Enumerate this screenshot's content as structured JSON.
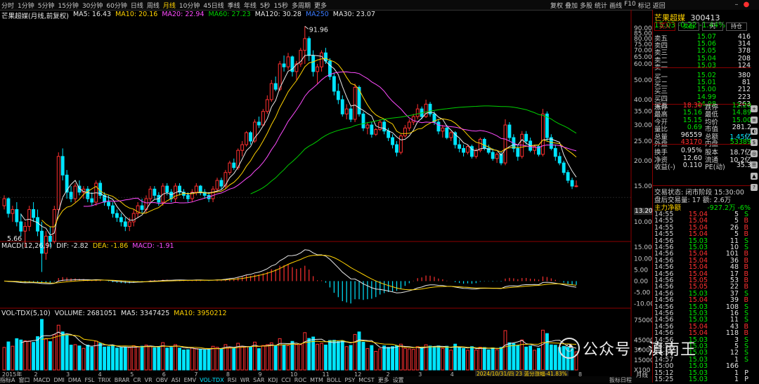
{
  "toolbar": {
    "periods": [
      "分时",
      "1分钟",
      "5分钟",
      "15分钟",
      "30分钟",
      "60分钟",
      "日线",
      "周线",
      "月线",
      "10分钟",
      "45日线",
      "季线",
      "年线",
      "5秒",
      "15秒",
      "多周期",
      "更多"
    ],
    "active_period": "月线",
    "right_tools": [
      "复权",
      "叠加",
      "多股",
      "统计",
      "画线",
      "F10",
      "标记",
      "返回"
    ]
  },
  "main_info": {
    "title": "芒果超媒(月线,前复权)",
    "ma5": "MA5: 16.43",
    "ma10": "MA10: 20.16",
    "ma20": "MA20: 22.94",
    "ma60": "MA60: 27.23",
    "ma120": "MA120: 30.28",
    "ma250": "MA250",
    "ma30": "MA30: 23.07"
  },
  "macd_info": {
    "title": "MACD(12,26,9)",
    "dif": "DIF: -2.82",
    "dea": "DEA: -1.86",
    "macd": "MACD: -1.91"
  },
  "vol_info": {
    "title": "VOL-TDX(5,10)",
    "volume": "VOLUME: 2681051",
    "ma5": "MA5: 3347425",
    "ma10": "MA10: 3950212"
  },
  "annotations": {
    "high": "91.96",
    "low": "5.66",
    "current_ref": "13.20"
  },
  "colors": {
    "up": "#ff3030",
    "down": "#00e5ff",
    "ma5": "#e8e8e8",
    "ma10": "#ffd200",
    "ma20": "#ff4cff",
    "ma60": "#00d000",
    "ma120": "#c8c8c8"
  },
  "chart_data": {
    "type": "candlestick",
    "main_axis_ticks": [
      "90.00",
      "85.00",
      "80.00",
      "75.00",
      "70.00",
      "65.00",
      "60.00",
      "50.00",
      "40.00",
      "35.00",
      "30.00",
      "25.00",
      "20.00",
      "15.00",
      "10.00"
    ],
    "macd_axis_ticks": [
      "15.00",
      "10.00",
      "5.00",
      "0.00",
      "-5.00",
      "-10.00"
    ],
    "vol_axis_ticks": [
      "75000",
      "45000",
      "30000",
      "15000",
      "X100"
    ],
    "x_labels": [
      "2015年",
      "2",
      "3",
      "4",
      "5",
      "6",
      "7",
      "8",
      "9",
      "10",
      "11",
      "12",
      "2",
      "3",
      "4",
      "5",
      "6",
      "7",
      "8"
    ],
    "candles": [
      [
        12.0,
        13.5,
        11.5,
        13.0
      ],
      [
        13.0,
        13.2,
        10.5,
        11.0
      ],
      [
        11.0,
        12.0,
        10.0,
        11.5
      ],
      [
        11.5,
        12.5,
        9.5,
        10.0
      ],
      [
        10.0,
        11.0,
        8.5,
        9.0
      ],
      [
        9.0,
        10.0,
        7.5,
        9.5
      ],
      [
        9.5,
        12.0,
        9.0,
        11.5
      ],
      [
        11.5,
        12.5,
        10.0,
        10.5
      ],
      [
        10.5,
        11.5,
        8.5,
        9.0
      ],
      [
        9.0,
        10.0,
        5.66,
        7.0
      ],
      [
        7.0,
        9.0,
        6.5,
        8.5
      ],
      [
        8.5,
        9.5,
        7.5,
        8.0
      ],
      [
        8.0,
        12.0,
        7.8,
        11.5
      ],
      [
        11.5,
        22.0,
        11.0,
        21.0
      ],
      [
        21.0,
        23.0,
        16.0,
        17.0
      ],
      [
        17.0,
        18.0,
        13.0,
        14.0
      ],
      [
        14.0,
        15.0,
        12.5,
        13.0
      ],
      [
        13.0,
        15.5,
        12.5,
        15.0
      ],
      [
        15.0,
        16.0,
        13.5,
        14.0
      ],
      [
        14.0,
        15.0,
        13.0,
        14.5
      ],
      [
        14.5,
        15.0,
        12.5,
        13.0
      ],
      [
        13.0,
        14.0,
        12.0,
        12.5
      ],
      [
        12.5,
        16.0,
        12.0,
        15.5
      ],
      [
        15.5,
        16.0,
        13.0,
        13.5
      ],
      [
        13.5,
        14.0,
        12.0,
        12.5
      ],
      [
        12.5,
        13.5,
        11.5,
        12.0
      ],
      [
        12.0,
        12.5,
        10.5,
        11.0
      ],
      [
        11.0,
        11.5,
        10.0,
        10.5
      ],
      [
        10.5,
        11.0,
        9.5,
        10.0
      ],
      [
        10.0,
        10.5,
        9.0,
        9.5
      ],
      [
        9.5,
        10.5,
        9.0,
        10.0
      ],
      [
        10.0,
        11.5,
        9.5,
        11.0
      ],
      [
        11.0,
        12.5,
        10.5,
        12.0
      ],
      [
        12.0,
        13.0,
        11.0,
        11.5
      ],
      [
        11.5,
        13.5,
        11.0,
        13.0
      ],
      [
        13.0,
        15.0,
        12.5,
        14.5
      ],
      [
        14.5,
        15.0,
        13.0,
        13.5
      ],
      [
        13.5,
        14.0,
        12.0,
        12.5
      ],
      [
        12.5,
        15.5,
        12.0,
        15.0
      ],
      [
        15.0,
        15.5,
        13.5,
        14.0
      ],
      [
        14.0,
        14.5,
        12.5,
        13.0
      ],
      [
        13.0,
        15.5,
        12.5,
        15.0
      ],
      [
        15.0,
        15.5,
        13.5,
        14.0
      ],
      [
        14.0,
        14.5,
        13.0,
        13.5
      ],
      [
        13.5,
        14.0,
        12.5,
        13.0
      ],
      [
        13.0,
        14.5,
        12.5,
        14.0
      ],
      [
        14.0,
        15.5,
        13.5,
        15.0
      ],
      [
        15.0,
        15.2,
        13.5,
        14.0
      ],
      [
        14.0,
        14.5,
        13.0,
        13.5
      ],
      [
        13.5,
        14.0,
        12.5,
        13.0
      ],
      [
        13.0,
        15.0,
        12.5,
        14.5
      ],
      [
        14.5,
        16.5,
        14.0,
        16.0
      ],
      [
        16.0,
        16.5,
        14.5,
        15.0
      ],
      [
        15.0,
        18.0,
        14.5,
        17.5
      ],
      [
        17.5,
        20.0,
        17.0,
        19.5
      ],
      [
        19.5,
        20.5,
        18.0,
        18.5
      ],
      [
        18.5,
        23.0,
        18.0,
        22.5
      ],
      [
        22.5,
        25.0,
        21.0,
        24.0
      ],
      [
        24.0,
        28.0,
        23.5,
        27.5
      ],
      [
        27.5,
        28.0,
        24.0,
        25.0
      ],
      [
        25.0,
        32.0,
        24.5,
        31.0
      ],
      [
        31.0,
        33.0,
        29.0,
        30.0
      ],
      [
        30.0,
        36.0,
        29.5,
        35.0
      ],
      [
        35.0,
        42.0,
        34.0,
        40.0
      ],
      [
        40.0,
        50.0,
        39.0,
        48.0
      ],
      [
        48.0,
        52.0,
        44.0,
        45.0
      ],
      [
        45.0,
        62.0,
        44.0,
        60.0
      ],
      [
        60.0,
        66.0,
        55.0,
        58.0
      ],
      [
        58.0,
        68.0,
        56.0,
        65.0
      ],
      [
        65.0,
        66.0,
        52.0,
        55.0
      ],
      [
        55.0,
        62.0,
        50.0,
        60.0
      ],
      [
        60.0,
        72.0,
        58.0,
        70.0
      ],
      [
        70.0,
        91.96,
        60.0,
        80.0
      ],
      [
        80.0,
        82.0,
        62.0,
        66.0
      ],
      [
        66.0,
        70.0,
        52.0,
        55.0
      ],
      [
        55.0,
        60.0,
        48.0,
        58.0
      ],
      [
        58.0,
        70.0,
        55.0,
        68.0
      ],
      [
        68.0,
        72.0,
        60.0,
        62.0
      ],
      [
        62.0,
        64.0,
        50.0,
        52.0
      ],
      [
        52.0,
        54.0,
        42.0,
        44.0
      ],
      [
        44.0,
        48.0,
        38.0,
        40.0
      ],
      [
        40.0,
        42.0,
        33.0,
        34.0
      ],
      [
        34.0,
        38.0,
        32.0,
        36.0
      ],
      [
        36.0,
        37.0,
        31.0,
        32.0
      ],
      [
        32.0,
        48.0,
        31.0,
        46.0
      ],
      [
        46.0,
        47.0,
        33.0,
        34.0
      ],
      [
        34.0,
        35.0,
        28.0,
        29.0
      ],
      [
        29.0,
        31.0,
        27.0,
        30.0
      ],
      [
        30.0,
        31.0,
        26.0,
        27.0
      ],
      [
        27.0,
        29.0,
        26.5,
        28.5
      ],
      [
        28.5,
        32.0,
        28.0,
        31.0
      ],
      [
        31.0,
        32.0,
        27.0,
        28.0
      ],
      [
        28.0,
        29.0,
        25.0,
        26.0
      ],
      [
        26.0,
        27.0,
        23.0,
        24.0
      ],
      [
        24.0,
        25.0,
        21.0,
        22.0
      ],
      [
        22.0,
        27.0,
        21.5,
        26.5
      ],
      [
        26.5,
        30.0,
        26.0,
        29.0
      ],
      [
        29.0,
        32.0,
        28.0,
        31.0
      ],
      [
        31.0,
        34.0,
        30.0,
        33.0
      ],
      [
        33.0,
        38.0,
        32.0,
        36.0
      ],
      [
        36.0,
        37.0,
        32.0,
        33.0
      ],
      [
        33.0,
        40.0,
        32.5,
        38.0
      ],
      [
        38.0,
        39.0,
        33.0,
        34.0
      ],
      [
        34.0,
        35.0,
        30.0,
        31.0
      ],
      [
        31.0,
        32.0,
        27.0,
        28.0
      ],
      [
        28.0,
        30.0,
        26.0,
        29.0
      ],
      [
        29.0,
        30.0,
        25.5,
        26.0
      ],
      [
        26.0,
        28.0,
        25.0,
        27.5
      ],
      [
        27.5,
        28.0,
        23.0,
        24.0
      ],
      [
        24.0,
        25.5,
        22.0,
        23.0
      ],
      [
        23.0,
        24.0,
        21.0,
        22.0
      ],
      [
        22.0,
        24.0,
        21.5,
        23.5
      ],
      [
        23.5,
        24.0,
        20.5,
        21.0
      ],
      [
        21.0,
        23.0,
        20.5,
        22.5
      ],
      [
        22.5,
        26.0,
        22.0,
        25.5
      ],
      [
        25.5,
        26.0,
        22.5,
        23.0
      ],
      [
        23.0,
        24.0,
        21.5,
        22.0
      ],
      [
        22.0,
        23.0,
        20.0,
        20.5
      ],
      [
        20.5,
        22.0,
        19.5,
        21.5
      ],
      [
        21.5,
        22.0,
        19.0,
        19.5
      ],
      [
        19.5,
        32.0,
        19.0,
        30.0
      ],
      [
        30.0,
        31.0,
        25.0,
        26.0
      ],
      [
        26.0,
        27.0,
        22.0,
        23.0
      ],
      [
        23.0,
        24.0,
        20.0,
        21.0
      ],
      [
        21.0,
        28.0,
        20.5,
        27.0
      ],
      [
        27.0,
        28.0,
        24.0,
        25.0
      ],
      [
        25.0,
        26.0,
        22.0,
        22.5
      ],
      [
        22.5,
        24.0,
        21.5,
        23.5
      ],
      [
        23.5,
        24.0,
        21.0,
        21.5
      ],
      [
        21.5,
        36.0,
        21.0,
        34.0
      ],
      [
        34.0,
        35.0,
        25.0,
        26.0
      ],
      [
        26.0,
        27.0,
        22.5,
        23.0
      ],
      [
        23.0,
        24.0,
        20.0,
        21.0
      ],
      [
        21.0,
        22.0,
        19.0,
        19.5
      ],
      [
        19.5,
        20.0,
        17.0,
        17.5
      ],
      [
        17.5,
        18.0,
        15.5,
        16.0
      ],
      [
        16.0,
        16.5,
        14.5,
        15.0
      ],
      [
        15.0,
        16.0,
        14.8,
        15.03
      ]
    ]
  },
  "right_panel": {
    "name": "芒果超媒",
    "code": "300413",
    "price_line": "15.03  -0.22  -1.44%",
    "buttons": [
      "买入",
      "卖出",
      "闪",
      "持仓"
    ],
    "asks": [
      {
        "label": "卖五",
        "price": "15.07",
        "vol": "416"
      },
      {
        "label": "卖四",
        "price": "15.06",
        "vol": "314"
      },
      {
        "label": "卖三",
        "price": "15.05",
        "vol": "378"
      },
      {
        "label": "卖二",
        "price": "15.04",
        "vol": "208"
      },
      {
        "label": "卖一",
        "price": "15.03",
        "vol": "124"
      }
    ],
    "bids": [
      {
        "label": "买一",
        "price": "15.02",
        "vol": "380"
      },
      {
        "label": "买二",
        "price": "15.01",
        "vol": "81"
      },
      {
        "label": "买三",
        "price": "15.00",
        "vol": "212"
      },
      {
        "label": "买四",
        "price": "14.99",
        "vol": "223"
      },
      {
        "label": "买五",
        "price": "14.98",
        "vol": "263"
      }
    ],
    "stats": [
      {
        "l": "涨停",
        "v": "18.30",
        "vc": "#ff3030",
        "l2": "跌停",
        "v2": "12.20",
        "v2c": "#00e600"
      },
      {
        "l": "最高",
        "v": "15.16",
        "vc": "#00e600",
        "l2": "最低",
        "v2": "14.89",
        "v2c": "#00e600"
      },
      {
        "l": "今开",
        "v": "15.15",
        "vc": "#00e600",
        "l2": "均价",
        "v2": "15.00",
        "v2c": "#00e600"
      },
      {
        "l": "量比",
        "v": "0.69",
        "vc": "#00e600",
        "l2": "市值",
        "v2": "281.2亿",
        "v2c": "#e8e8e8"
      },
      {
        "l": "总量",
        "v": "96559",
        "vc": "#e8e8e8",
        "l2": "总额",
        "v2": "1.45亿",
        "v2c": "#00e5ff"
      },
      {
        "l": "外盘",
        "v": "43170",
        "vc": "#ff3030",
        "l2": "内盘",
        "v2": "53389",
        "v2c": "#00e600"
      },
      {
        "l": "换手",
        "v": "0.95%",
        "vc": "#e8e8e8",
        "l2": "股本",
        "v2": "18.7亿",
        "v2c": "#e8e8e8"
      },
      {
        "l": "净资",
        "v": "12.60",
        "vc": "#e8e8e8",
        "l2": "流通",
        "v2": "10.2亿",
        "v2c": "#e8e8e8"
      },
      {
        "l": "收益(-)",
        "v": "0.110",
        "vc": "#e8e8e8",
        "l2": "PE(动)",
        "v2": "35.3",
        "v2c": "#e8e8e8"
      }
    ],
    "trade_status": "交易状态: 闭市阶段 15:30:00",
    "after_hours": "盘后交易量: 17  额: 2.6万",
    "main_flow_label": "主力净额",
    "main_flow_value": "-927.2万 -6%",
    "ticks": [
      {
        "t": "14:55",
        "p": "15.04",
        "v": "5",
        "s": "S"
      },
      {
        "t": "14:55",
        "p": "15.04",
        "v": "5",
        "s": "B"
      },
      {
        "t": "14:55",
        "p": "15.04",
        "v": "26",
        "s": "B"
      },
      {
        "t": "14:55",
        "p": "15.04",
        "v": "5",
        "s": "B"
      },
      {
        "t": "14:56",
        "p": "15.03",
        "v": "11",
        "s": "S"
      },
      {
        "t": "14:56",
        "p": "15.03",
        "v": "10",
        "s": "S"
      },
      {
        "t": "14:56",
        "p": "15.04",
        "v": "101",
        "s": "B"
      },
      {
        "t": "14:56",
        "p": "15.04",
        "v": "36",
        "s": "B"
      },
      {
        "t": "14:56",
        "p": "15.04",
        "v": "48",
        "s": "B"
      },
      {
        "t": "14:56",
        "p": "15.04",
        "v": "17",
        "s": "B"
      },
      {
        "t": "14:56",
        "p": "15.05",
        "v": "53",
        "s": "B"
      },
      {
        "t": "14:56",
        "p": "15.05",
        "v": "22",
        "s": "B"
      },
      {
        "t": "14:56",
        "p": "15.03",
        "v": "37",
        "s": "S"
      },
      {
        "t": "14:56",
        "p": "15.04",
        "v": "39",
        "s": "B"
      },
      {
        "t": "14:56",
        "p": "15.03",
        "v": "108",
        "s": "S"
      },
      {
        "t": "14:56",
        "p": "15.03",
        "v": "16",
        "s": "S"
      },
      {
        "t": "14:56",
        "p": "15.03",
        "v": "11",
        "s": "S"
      },
      {
        "t": "14:56",
        "p": "15.04",
        "v": "43",
        "s": "B"
      },
      {
        "t": "14:56",
        "p": "15.04",
        "v": "118",
        "s": "B"
      },
      {
        "t": "14:56",
        "p": "15.03",
        "v": "3",
        "s": "S"
      },
      {
        "t": "14:56",
        "p": "15.03",
        "v": "5",
        "s": "S"
      },
      {
        "t": "14:56",
        "p": "15.03",
        "v": "12",
        "s": "S"
      },
      {
        "t": "14:57",
        "p": "15.03",
        "v": "1",
        "s": "S"
      },
      {
        "t": "15:00",
        "p": "15.03",
        "v": "166",
        "s": ""
      },
      {
        "t": "15:12",
        "p": "15.03",
        "v": "1",
        "s": "P"
      },
      {
        "t": "15:25",
        "p": "15.03",
        "v": "1",
        "s": "P"
      }
    ]
  },
  "bottom_tabs": [
    "指标A",
    "窗口",
    "MACD",
    "DMI",
    "DMA",
    "FSL",
    "TRIX",
    "BRAR",
    "CR",
    "VR",
    "OBV",
    "ASI",
    "EMV",
    "VOL-TDX",
    "RSI",
    "WR",
    "SAR",
    "KDJ",
    "CCI",
    "ROC",
    "MTM",
    "BOLL",
    "PSY",
    "MCST",
    "更多",
    "设置"
  ],
  "bottom_right": "扳标日程",
  "bottom_right2": "月线",
  "hover_date": "2024/10/31/四 23 蓝分涨幅-41.83%",
  "date_start": "2015年",
  "watermark": "公众号 · 滇南王"
}
